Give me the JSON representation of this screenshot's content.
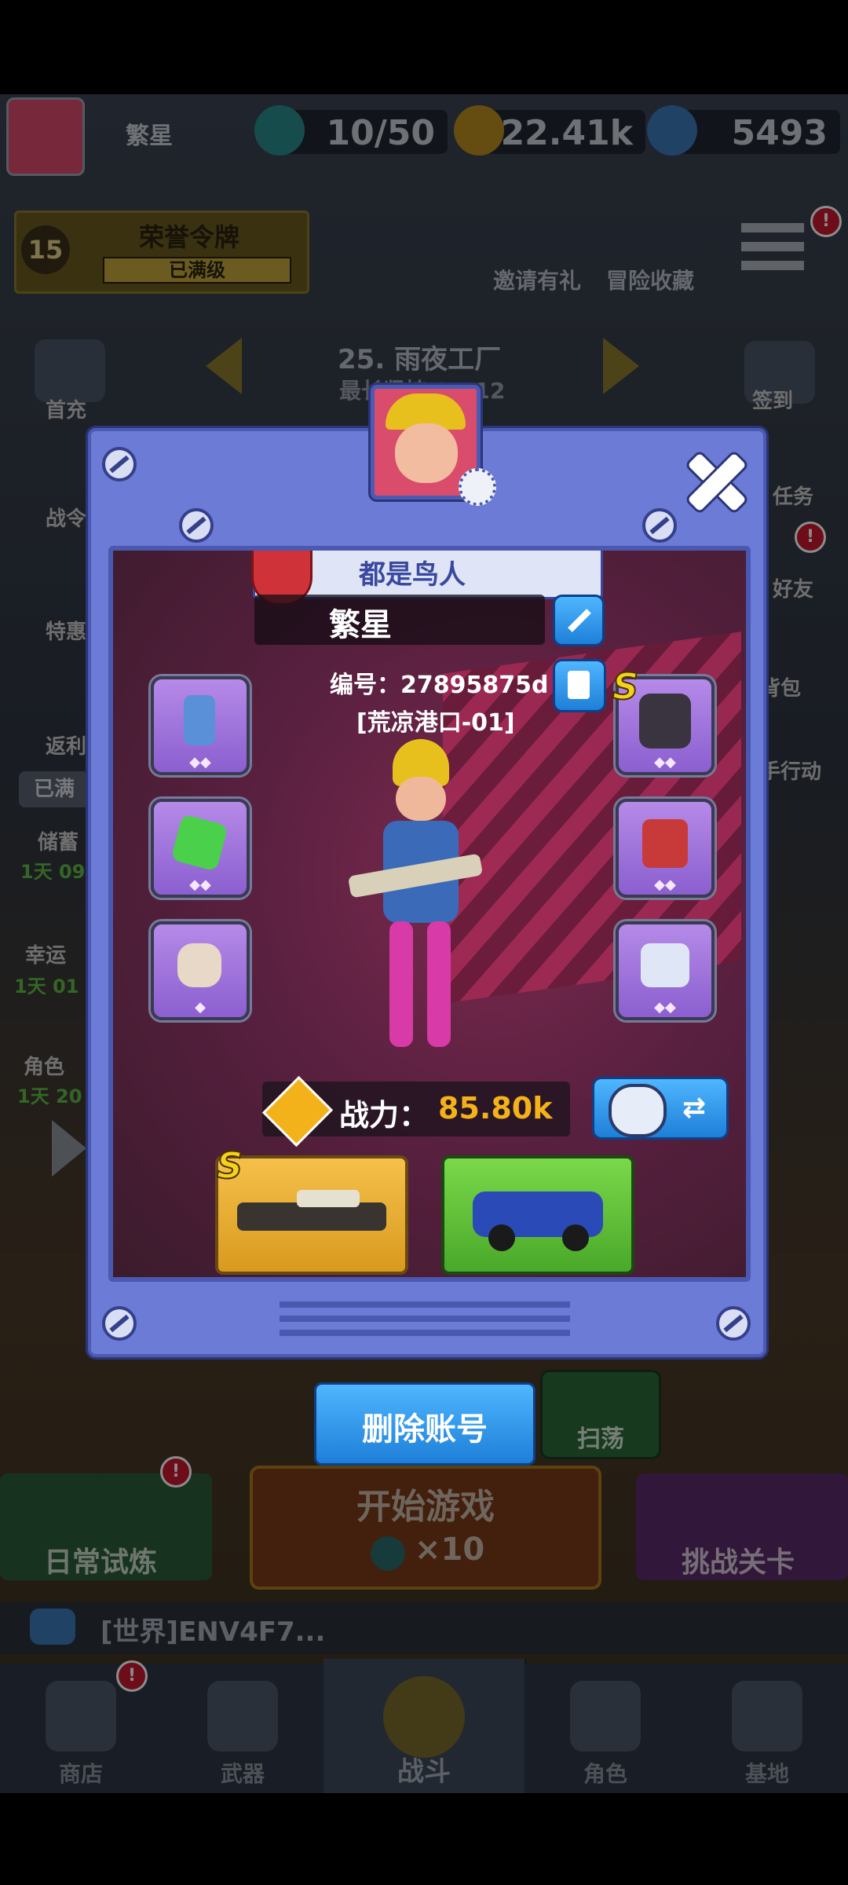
{
  "status_bar": {
    "height_note": ""
  },
  "top_bar": {
    "player_name": "繁星",
    "energy": "10/50",
    "coins": "22.41k",
    "gems": "5493"
  },
  "honor": {
    "level": "15",
    "title": "荣誉令牌",
    "status": "已满级"
  },
  "top_right": {
    "invite": "邀请有礼",
    "bookmark": "冒险收藏"
  },
  "stage": {
    "name": "25. 雨夜工厂",
    "subtitle": "最长坚持 25-12"
  },
  "left_side": {
    "recharge": "首充",
    "pass": "战令",
    "special": "特惠",
    "rebate": "返利",
    "full_tag": "已满",
    "savings": "储蓄",
    "savings_timer": "1天 09",
    "lucky": "幸运",
    "lucky_timer": "1天 01",
    "role": "角色",
    "role_timer": "1天 20"
  },
  "right_side": {
    "signin": "签到",
    "task": "任务",
    "friends": "好友",
    "bag": "背包",
    "manual": "手行动"
  },
  "profile": {
    "guild": "都是鸟人",
    "name": "繁星",
    "id_line": "编号：27895875d",
    "server": "[荒凉港口-01]",
    "power_label": "战力：",
    "power_value": "85.80k",
    "left_slots": [
      "◆◆",
      "◆◆",
      "◆"
    ],
    "right_slots": [
      "◆◆",
      "◆◆",
      "◆◆"
    ],
    "s_label": "S",
    "weapon_s": "S"
  },
  "buttons": {
    "delete_account": "删除账号",
    "sweep": "扫荡"
  },
  "bottom_actions": {
    "daily": "日常试炼",
    "start": "开始游戏",
    "start_cost": "×10",
    "challenge": "挑战关卡"
  },
  "chat": {
    "text": "[世界]ENV4F7..."
  },
  "nav": {
    "shop": "商店",
    "weapon": "武器",
    "battle": "战斗",
    "role": "角色",
    "base": "基地"
  },
  "badges": {
    "alert": "!"
  },
  "colors": {
    "modal": "#6b7bd6",
    "power": "#f4b21a",
    "gold": "#e5b53a"
  }
}
